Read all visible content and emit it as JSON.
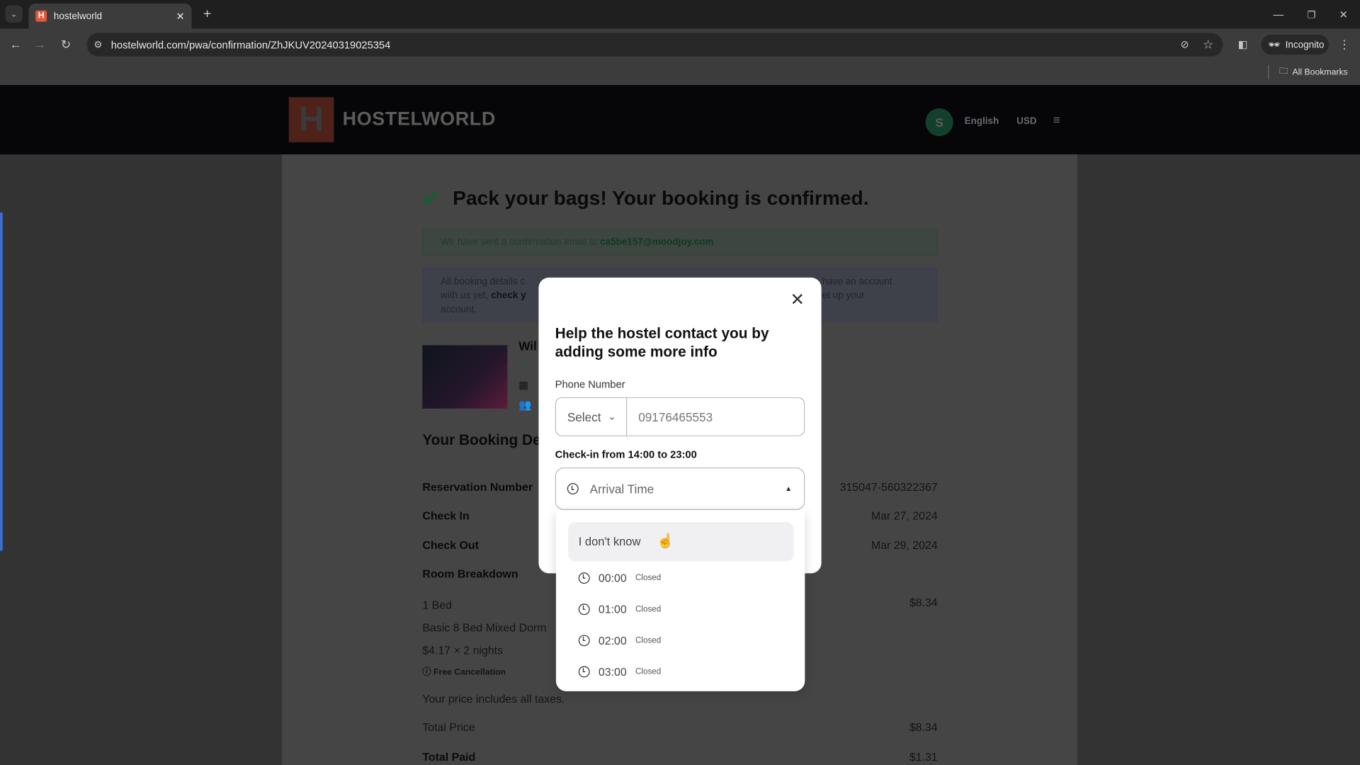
{
  "browser": {
    "tab_title": "hostelworld",
    "url": "hostelworld.com/pwa/confirmation/ZhJKUV20240319025354",
    "incognito_label": "Incognito",
    "bookmarks_label": "All Bookmarks"
  },
  "site_header": {
    "logo": "HOSTELWORLD",
    "avatar_initial": "S",
    "language": "English",
    "currency": "USD"
  },
  "page": {
    "title": "Pack your bags! Your booking is confirmed.",
    "email_notice": "We have sent a confirmation email to",
    "email": "ca5be157@moodjoy.com",
    "info_line1_start": "All booking details c",
    "info_line1_end": "have an account",
    "info_line2_start": "with us yet,",
    "info_line2_link": "check y",
    "info_line2_end": "et up your",
    "info_line3": "account.",
    "property_name_partial": "Wil",
    "booking_details_title": "Your Booking De",
    "rows": [
      {
        "label": "Reservation Number",
        "value": "315047-560322367"
      },
      {
        "label": "Check In",
        "value": "Mar 27, 2024"
      },
      {
        "label": "Check Out",
        "value": "Mar 29, 2024"
      }
    ],
    "room_breakdown_label": "Room Breakdown",
    "bed": "1 Bed",
    "bed_price": "$8.34",
    "room_type": "Basic 8 Bed Mixed Dorm",
    "nights": "$4.17 × 2 nights",
    "free_cancellation": "Free Cancellation",
    "taxes_note": "Your price includes all taxes.",
    "total_price_label": "Total Price",
    "total_price": "$8.34",
    "total_paid_label": "Total Paid",
    "total_paid": "$1.31"
  },
  "modal": {
    "title": "Help the hostel contact you by adding some more info",
    "phone_label": "Phone Number",
    "country_select": "Select",
    "phone_value": "09176465553",
    "checkin_label": "Check-in from 14:00 to 23:00",
    "arrival_placeholder": "Arrival Time",
    "options": [
      {
        "label": "I don't know"
      },
      {
        "label": "00:00",
        "status": "Closed"
      },
      {
        "label": "01:00",
        "status": "Closed"
      },
      {
        "label": "02:00",
        "status": "Closed"
      },
      {
        "label": "03:00",
        "status": "Closed"
      }
    ]
  },
  "colors": {
    "brand": "#e2573b",
    "success": "#1a7f4b",
    "avatar": "#1f8a5b"
  }
}
